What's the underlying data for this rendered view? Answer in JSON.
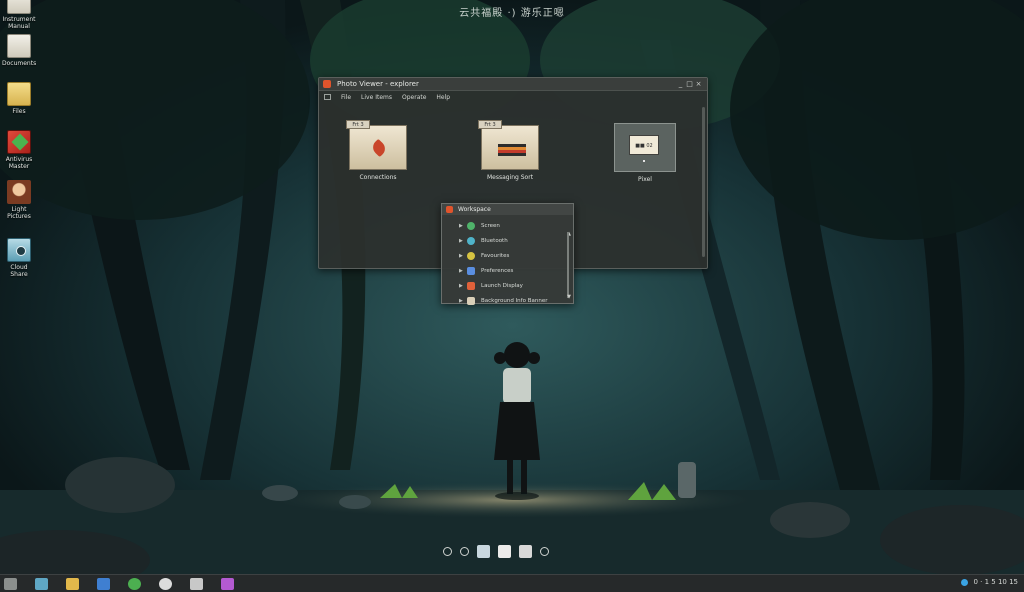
{
  "desktop": {
    "clock": "云共福殿 ·) 游乐正嗯",
    "icons": [
      {
        "label": "Instrument Manual",
        "icon": "document-icon"
      },
      {
        "label": "Documents",
        "icon": "document-icon"
      },
      {
        "label": "Files",
        "icon": "folder-icon"
      },
      {
        "label": "Antivirus Master",
        "icon": "app-icon"
      },
      {
        "label": "Light Pictures",
        "icon": "avatar-icon"
      },
      {
        "label": "Cloud Share",
        "icon": "camera-icon"
      }
    ]
  },
  "window": {
    "title": "Photo Viewer - explorer",
    "controls": [
      "_",
      "□",
      "×"
    ],
    "menu": [
      "File",
      "Live Items",
      "Operate",
      "Help"
    ],
    "tiles": [
      {
        "label": "Connections",
        "tab": "Frt 3",
        "icon": "leaf-thumbnail-icon"
      },
      {
        "label": "Messaging Sort",
        "tab": "Frt 3",
        "icon": "stripes-thumbnail-icon"
      },
      {
        "label": "Pixel",
        "tab": "",
        "card": "■■ 02",
        "icon": "card-thumbnail-icon"
      }
    ]
  },
  "popup": {
    "title": "Workspace",
    "items": [
      {
        "label": "Screen",
        "color": "#4fb36a"
      },
      {
        "label": "Bluetooth",
        "color": "#4fb3c9"
      },
      {
        "label": "Favourites",
        "color": "#d6c341"
      },
      {
        "label": "Preferences",
        "color": "#5a8ee0"
      },
      {
        "label": "Launch Display",
        "color": "#e0613a"
      },
      {
        "label": "Background Info Banner",
        "color": "#d9cfb8"
      }
    ],
    "scroll_up": "▲",
    "scroll_down": "▼"
  },
  "dock": [
    {
      "name": "back-icon",
      "kind": "circle"
    },
    {
      "name": "forward-icon",
      "kind": "circle"
    },
    {
      "name": "browser-icon",
      "color": "#c8d7df"
    },
    {
      "name": "terminal-icon",
      "color": "#ecebea"
    },
    {
      "name": "files-icon",
      "color": "#d8d8d8"
    },
    {
      "name": "settings-icon",
      "kind": "circle"
    }
  ],
  "taskbar": {
    "buttons": [
      {
        "name": "start-menu-icon",
        "color": "#8b8f8d"
      },
      {
        "name": "show-desktop-icon",
        "color": "#5fa7c4"
      },
      {
        "name": "file-manager-icon",
        "color": "#e2b84b"
      },
      {
        "name": "mail-icon",
        "color": "#3f7fd1"
      },
      {
        "name": "music-icon",
        "color": "#4caf50"
      },
      {
        "name": "search-icon",
        "color": "#dcdcdc"
      },
      {
        "name": "notes-icon",
        "color": "#c8c8c8"
      },
      {
        "name": "app-grid-icon",
        "color": "#b35ad1"
      }
    ],
    "tray_text": "0 · 1 5 10 15"
  }
}
